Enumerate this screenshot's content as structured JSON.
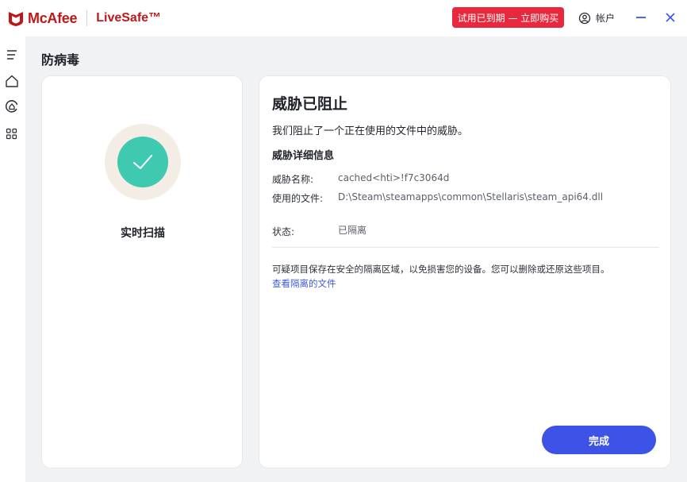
{
  "header": {
    "brand": "McAfee",
    "product": "LiveSafe™",
    "trial_button": "试用已到期 — 立即购买",
    "account_label": "帐户"
  },
  "page": {
    "title": "防病毒"
  },
  "left_card": {
    "status_label": "实时扫描"
  },
  "threat": {
    "title": "威胁已阻止",
    "description": "我们阻止了一个正在使用的文件中的威胁。",
    "details_heading": "威胁详细信息",
    "rows": [
      {
        "label": "威胁名称:",
        "value": "cached<hti>!f7c3064d"
      },
      {
        "label": "使用的文件:",
        "value": "D:\\Steam\\steamapps\\common\\Stellaris\\steam_api64.dll"
      },
      {
        "label": "状态:",
        "value": "已隔离"
      }
    ],
    "quarantine_note": "可疑项目保存在安全的隔离区域，以免损害您的设备。您可以删除或还原这些项目。",
    "view_link": "查看隔离的文件",
    "done_button": "完成"
  },
  "colors": {
    "brand_red": "#c01818",
    "trial_red": "#e8283c",
    "primary_blue": "#3d53e8",
    "link_blue": "#3d5bd9",
    "check_green": "#3fc9b0"
  },
  "icons": {
    "logo": "mcafee-shield-icon",
    "account": "account-icon",
    "minimize": "minimize-icon",
    "close": "close-icon",
    "menu": "menu-icon",
    "home": "home-icon",
    "protection": "protection-icon",
    "apps": "apps-grid-icon",
    "check": "checkmark-icon"
  }
}
